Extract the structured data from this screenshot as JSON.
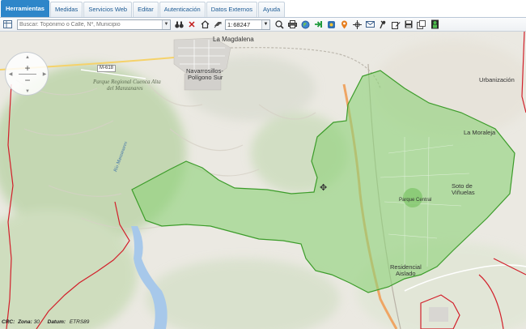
{
  "tabs": [
    {
      "label": "Herramientas",
      "active": true
    },
    {
      "label": "Medidas",
      "active": false
    },
    {
      "label": "Servicios Web",
      "active": false
    },
    {
      "label": "Editar",
      "active": false
    },
    {
      "label": "Autenticación",
      "active": false
    },
    {
      "label": "Datos Externos",
      "active": false
    },
    {
      "label": "Ayuda",
      "active": false
    }
  ],
  "toolbar": {
    "search_placeholder": "Buscar: Topónimo o Calle, Nº, Municipio",
    "scale_prefix": "1:",
    "scale_value": "68247"
  },
  "map": {
    "places": {
      "la_magdalena": "La Magdalena",
      "navarrosillos_line1": "Navarrosillos-",
      "navarrosillos_line2": "Polígono Sur",
      "urbanizacion": "Urbanización",
      "la_moraleja": "La Moraleja",
      "soto_line1": "Soto de",
      "soto_line2": "Viñuelas",
      "parque_central": "Parque Central",
      "residencial_line1": "Residencial",
      "residencial_line2": "Aislado",
      "road_m618": "M-618",
      "parque_line1": "Parque Regional Cuenca Alta",
      "parque_line2": "del Manzanares",
      "river": "Río Manzanares"
    },
    "colors": {
      "zone_fill": "#8fd27a",
      "zone_stroke": "#3c9c2a",
      "boundary": "#d21f2a",
      "water": "#a7c8ea"
    }
  },
  "status": {
    "crs_label": "CRC:",
    "zona_label": "Zona:",
    "zona_value": "30",
    "datum_label": "Datum:",
    "datum_value": "ETRS89"
  }
}
